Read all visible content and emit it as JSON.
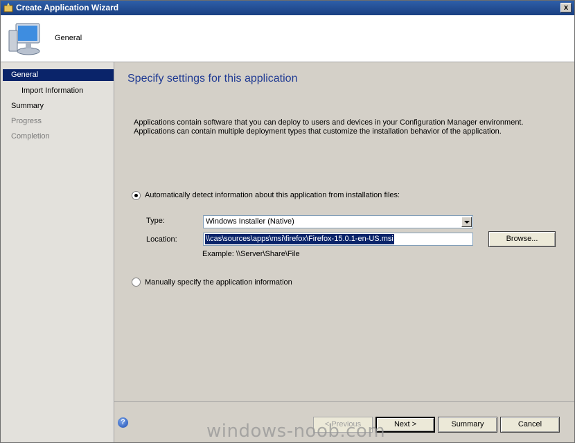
{
  "window": {
    "title": "Create Application Wizard",
    "close_glyph": "x"
  },
  "header": {
    "title": "General",
    "icon": "computer-icon"
  },
  "sidebar": {
    "items": [
      {
        "label": "General",
        "state": "selected"
      },
      {
        "label": "Import Information",
        "state": "sub"
      },
      {
        "label": "Summary",
        "state": "normal"
      },
      {
        "label": "Progress",
        "state": "disabled"
      },
      {
        "label": "Completion",
        "state": "disabled"
      }
    ]
  },
  "main": {
    "page_title": "Specify settings for this application",
    "description": "Applications contain software that you can deploy to users and devices in your Configuration Manager environment. Applications can contain multiple deployment types that customize the installation behavior of the application.",
    "auto_detect": {
      "label": "Automatically detect information about this application from installation files:",
      "checked": true
    },
    "type": {
      "label": "Type:",
      "value": "Windows Installer (Native)"
    },
    "location": {
      "label": "Location:",
      "value": "\\\\cas\\sources\\apps\\msi\\firefox\\Firefox-15.0.1-en-US.msi",
      "example": "Example: \\\\Server\\Share\\File"
    },
    "browse_label": "Browse...",
    "manual": {
      "label": "Manually specify the application information",
      "checked": false
    }
  },
  "footer": {
    "help_glyph": "?",
    "previous_label": "< Previous",
    "next_label": "Next >",
    "summary_label": "Summary",
    "cancel_label": "Cancel"
  },
  "watermark": "windows-noob.com",
  "colors": {
    "title_bar": "#1a3f82",
    "selection": "#0a246a",
    "page_title": "#1f3a93"
  }
}
